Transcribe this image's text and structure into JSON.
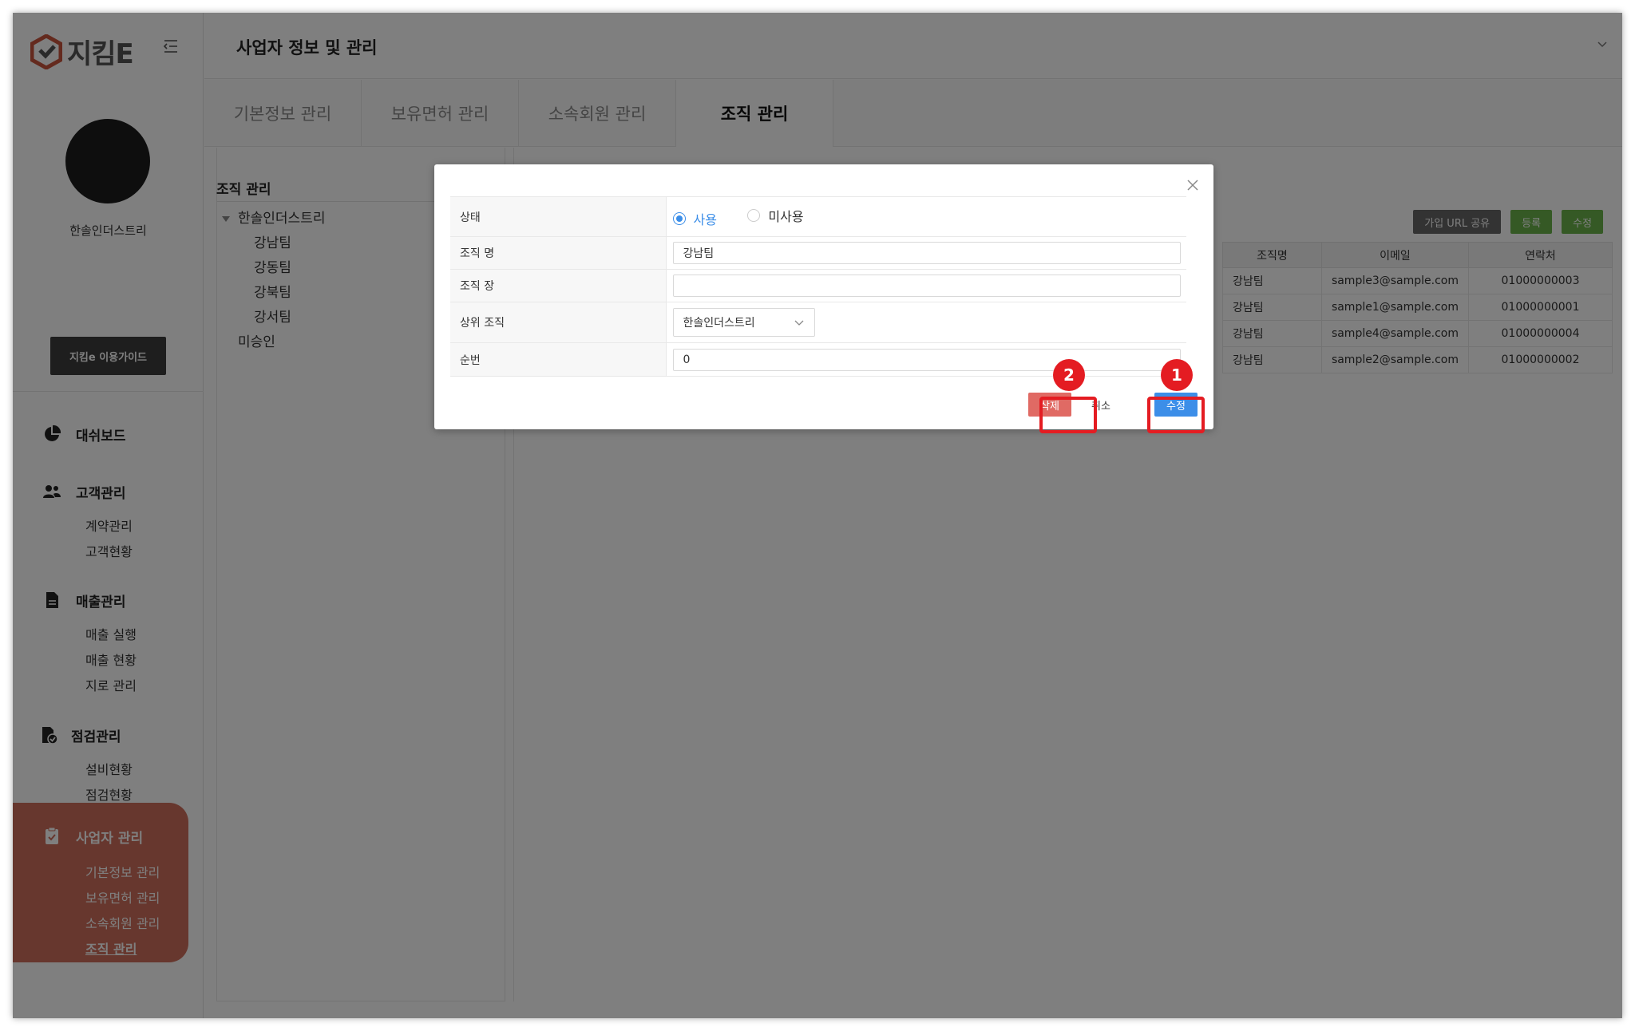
{
  "app": {
    "logo_text": "지킴E",
    "company": "한솔인더스트리",
    "guide_button": "지킴e 이용가이드"
  },
  "sidebar": {
    "groups": [
      {
        "label": "대쉬보드",
        "icon": "pie-chart-icon",
        "items": []
      },
      {
        "label": "고객관리",
        "icon": "users-icon",
        "items": [
          "계약관리",
          "고객현황"
        ]
      },
      {
        "label": "매출관리",
        "icon": "document-icon",
        "items": [
          "매출 실행",
          "매출 현황",
          "지로 관리"
        ]
      },
      {
        "label": "점검관리",
        "icon": "clipboard-check-icon",
        "items": [
          "설비현황",
          "점검현황"
        ]
      },
      {
        "label": "사업자 관리",
        "icon": "clipboard-icon",
        "items": [
          "기본정보 관리",
          "보유면허 관리",
          "소속회원 관리",
          "조직 관리"
        ]
      }
    ],
    "active_group": "사업자 관리",
    "active_item": "조직 관리"
  },
  "header": {
    "title": "사업자 정보 및 관리"
  },
  "tabs": [
    {
      "label": "기본정보 관리",
      "active": false
    },
    {
      "label": "보유면허 관리",
      "active": false
    },
    {
      "label": "소속회원 관리",
      "active": false
    },
    {
      "label": "조직 관리",
      "active": true
    }
  ],
  "tree": {
    "title": "조직 관리",
    "root": "한솔인더스트리",
    "children": [
      "강남팀",
      "강동팀",
      "강북팀",
      "강서팀"
    ],
    "unassigned": "미승인"
  },
  "grid": {
    "buttons": {
      "share_url": "가입 URL 공유",
      "register": "등록",
      "edit": "수정"
    },
    "columns": [
      "조직명",
      "이메일",
      "연락처"
    ],
    "rows": [
      {
        "team": "강남팀",
        "email": "sample3@sample.com",
        "phone": "01000000003"
      },
      {
        "team": "강남팀",
        "email": "sample1@sample.com",
        "phone": "01000000001"
      },
      {
        "team": "강남팀",
        "email": "sample4@sample.com",
        "phone": "01000000004"
      },
      {
        "team": "강남팀",
        "email": "sample2@sample.com",
        "phone": "01000000002"
      }
    ]
  },
  "modal": {
    "fields": {
      "status_label": "상태",
      "status_options": [
        "사용",
        "미사용"
      ],
      "status_selected": "사용",
      "name_label": "조직 명",
      "name_value": "강남팀",
      "leader_label": "조직 장",
      "leader_value": "",
      "parent_label": "상위 조직",
      "parent_value": "한솔인더스트리",
      "order_label": "순번",
      "order_value": "0"
    },
    "buttons": {
      "delete": "삭제",
      "cancel": "취소",
      "save": "수정"
    },
    "annotations": {
      "delete_badge": "2",
      "save_badge": "1"
    }
  },
  "colors": {
    "brand": "#cf6e5c",
    "primary": "#3c8ee8",
    "danger": "#e06a64",
    "success": "#6bb34a",
    "highlight": "#e41c22"
  }
}
